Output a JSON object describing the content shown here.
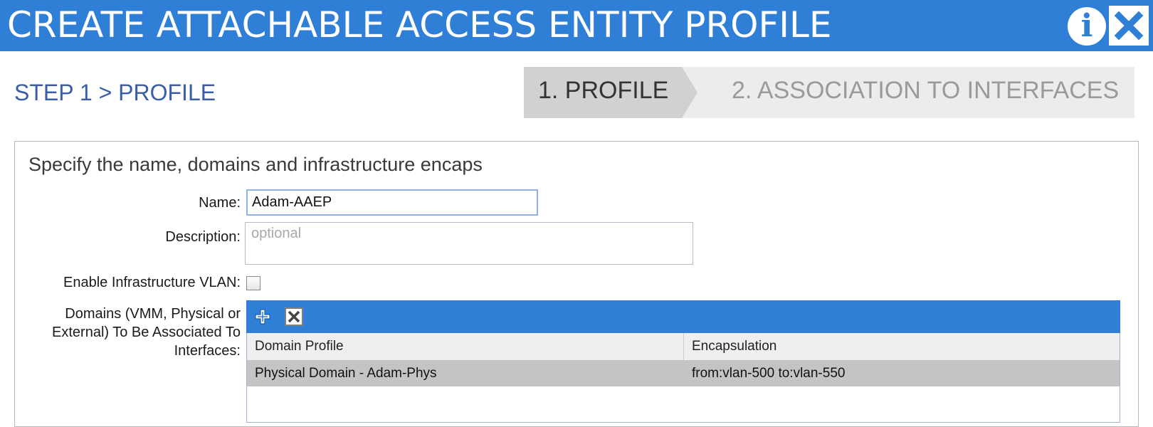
{
  "dialog": {
    "title": "CREATE ATTACHABLE ACCESS ENTITY PROFILE",
    "info_glyph": "i",
    "close_icon": "close-x-icon"
  },
  "step": {
    "title": "STEP 1 > PROFILE",
    "wizard_steps": [
      {
        "label": "1. PROFILE",
        "active": true
      },
      {
        "label": "2. ASSOCIATION TO INTERFACES",
        "active": false
      }
    ]
  },
  "form": {
    "heading": "Specify the name, domains and infrastructure encaps",
    "name_label": "Name:",
    "name_value": "Adam-AAEP",
    "description_label": "Description:",
    "description_placeholder": "optional",
    "infra_vlan_label": "Enable Infrastructure VLAN:",
    "infra_vlan_checked": false,
    "domains_label": "Domains (VMM, Physical or External) To Be Associated To Interfaces:"
  },
  "domains_table": {
    "toolbar_icons": [
      "add-icon",
      "delete-icon"
    ],
    "columns": [
      "Domain Profile",
      "Encapsulation"
    ],
    "rows": [
      [
        "Physical Domain - Adam-Phys",
        "from:vlan-500 to:vlan-550"
      ]
    ]
  },
  "colors": {
    "accent_blue": "#2f7fd6",
    "step_title_blue": "#3a5da8",
    "active_step_bg": "#d1d1d1",
    "inactive_step_bg": "#ececec",
    "selected_row_bg": "#c4c4c4"
  }
}
